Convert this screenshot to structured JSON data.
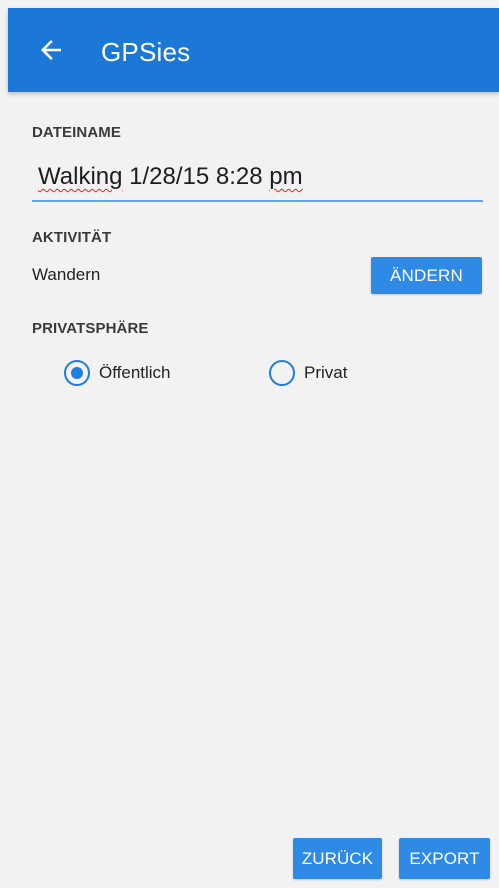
{
  "toolbar": {
    "title": "GPSies",
    "back_icon": "arrow-left-icon",
    "color": "#1b78d7"
  },
  "filename": {
    "label": "DATEINAME",
    "value_part1": "Walking",
    "value_part2": " 1/28/15 8:28 ",
    "value_part3": "pm"
  },
  "activity": {
    "label": "AKTIVITÄT",
    "value": "Wandern",
    "change_label": "ÄNDERN"
  },
  "privacy": {
    "label": "PRIVATSPHÄRE",
    "options": [
      {
        "label": "Öffentlich",
        "selected": true
      },
      {
        "label": "Privat",
        "selected": false
      }
    ]
  },
  "footer": {
    "back_label": "ZURÜCK",
    "export_label": "EXPORT"
  },
  "colors": {
    "accent": "#2f8ae6",
    "background": "#f2f2f2"
  }
}
